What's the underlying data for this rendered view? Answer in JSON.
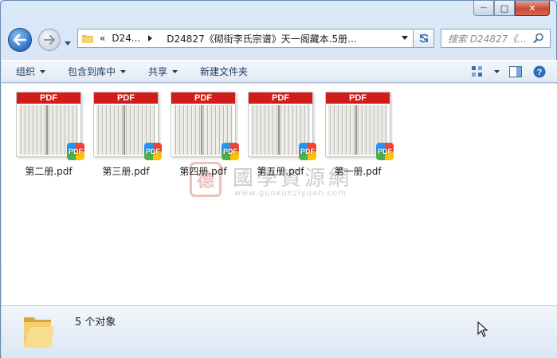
{
  "window": {
    "minimize_glyph": "—",
    "maximize_glyph": "□",
    "close_glyph": "✕"
  },
  "address_bar": {
    "prefix": "«",
    "crumb_1": "D24...",
    "crumb_2": "D24827《砌街李氏宗谱》天一阁藏本.5册..."
  },
  "search": {
    "placeholder": "搜索 D24827《..."
  },
  "toolbar": {
    "organize": "组织",
    "include_in_library": "包含到库中",
    "share": "共享",
    "new_folder": "新建文件夹"
  },
  "files": [
    {
      "name": "第二册.pdf",
      "band": "PDF",
      "badge": "PDF"
    },
    {
      "name": "第三册.pdf",
      "band": "PDF",
      "badge": "PDF"
    },
    {
      "name": "第四册.pdf",
      "band": "PDF",
      "badge": "PDF"
    },
    {
      "name": "第五册.pdf",
      "band": "PDF",
      "badge": "PDF"
    },
    {
      "name": "第一册.pdf",
      "band": "PDF",
      "badge": "PDF"
    }
  ],
  "watermark": {
    "seal": "德",
    "title": "國學資源網",
    "url": "www.guoxueziyuan.com"
  },
  "status": {
    "count": "5 个对象"
  },
  "colors": {
    "pdf_red": "#d21b1b",
    "accent_blue": "#2a6fc0",
    "close_red": "#c74a35"
  },
  "icons": [
    "back-arrow-icon",
    "forward-arrow-icon",
    "folder-icon",
    "refresh-icon",
    "search-icon",
    "view-options-icon",
    "preview-pane-icon",
    "help-icon",
    "pdf-badge-icon",
    "mouse-cursor-icon"
  ]
}
